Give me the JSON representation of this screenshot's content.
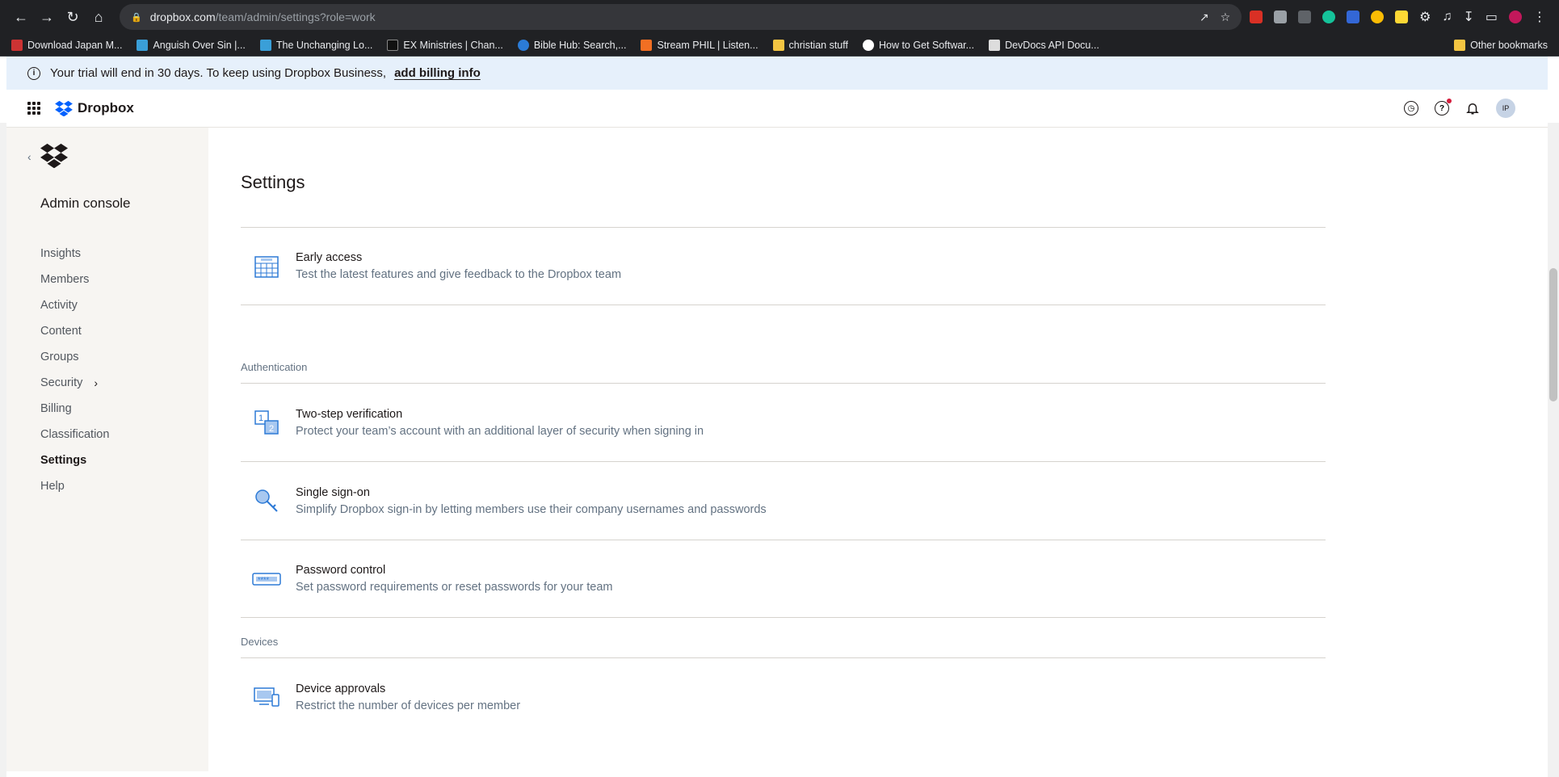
{
  "browser": {
    "url_host": "dropbox.com",
    "url_path": "/team/admin/settings?role=work",
    "bookmarks": [
      {
        "label": "Download Japan M...",
        "color": "#c33"
      },
      {
        "label": "Anguish Over Sin |...",
        "color": "#3a9fd8"
      },
      {
        "label": "The Unchanging Lo...",
        "color": "#3a9fd8"
      },
      {
        "label": "EX Ministries | Chan...",
        "color": "#111"
      },
      {
        "label": "Bible Hub: Search,...",
        "color": "#2b7bd6"
      },
      {
        "label": "Stream PHIL | Listen...",
        "color": "#f26f23"
      },
      {
        "label": "christian stuff",
        "color": "#f4c542"
      },
      {
        "label": "How to Get Softwar...",
        "color": "#fff"
      },
      {
        "label": "DevDocs API Docu...",
        "color": "#ddd"
      }
    ],
    "other_bookmarks": "Other bookmarks"
  },
  "banner": {
    "text": "Your trial will end in 30 days. To keep using Dropbox Business,",
    "link": "add billing info"
  },
  "topbar": {
    "brand": "Dropbox",
    "avatar_initials": "IP"
  },
  "sidebar": {
    "title": "Admin console",
    "items": [
      {
        "label": "Insights"
      },
      {
        "label": "Members"
      },
      {
        "label": "Activity"
      },
      {
        "label": "Content"
      },
      {
        "label": "Groups"
      },
      {
        "label": "Security"
      },
      {
        "label": "Billing"
      },
      {
        "label": "Classification"
      },
      {
        "label": "Settings"
      },
      {
        "label": "Help"
      }
    ]
  },
  "page": {
    "title": "Settings",
    "early_access": {
      "title": "Early access",
      "desc": "Test the latest features and give feedback to the Dropbox team"
    },
    "authentication": {
      "label": "Authentication",
      "rows": [
        {
          "title": "Two-step verification",
          "desc": "Protect your team’s account with an additional layer of security when signing in"
        },
        {
          "title": "Single sign-on",
          "desc": "Simplify Dropbox sign-in by letting members use their company usernames and passwords"
        },
        {
          "title": "Password control",
          "desc": "Set password requirements or reset passwords for your team"
        }
      ]
    },
    "devices": {
      "label": "Devices",
      "rows": [
        {
          "title": "Device approvals",
          "desc": "Restrict the number of devices per member"
        }
      ]
    }
  }
}
